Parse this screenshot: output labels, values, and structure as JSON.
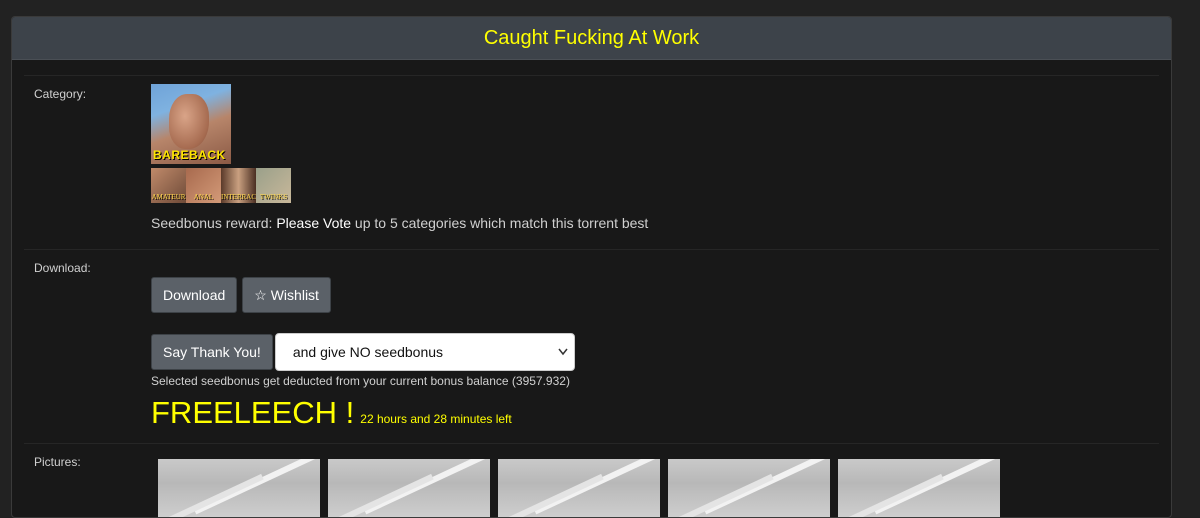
{
  "title": "Caught Fucking At Work",
  "category": {
    "label": "Category:",
    "main_name": "BAREBACK",
    "subcategories": [
      "AMATEUR",
      "ANAL",
      "INTERRACIAL",
      "TWINKS"
    ],
    "seedbonus_prefix": "Seedbonus reward: ",
    "seedbonus_link": "Please Vote",
    "seedbonus_suffix": " up to 5 categories which match this torrent best"
  },
  "download": {
    "label": "Download:",
    "download_button": "Download",
    "wishlist_button": "Wishlist",
    "thank_button": "Say Thank You!",
    "select_value": "and give NO seedbonus",
    "note": "Selected seedbonus get deducted from your current bonus balance (3957.932)",
    "freeleech": "FREELEECH !",
    "time_left": "22 hours and 28 minutes left"
  },
  "pictures": {
    "label": "Pictures:",
    "count": 5
  },
  "colors": {
    "accent_yellow": "#ffff00",
    "header_bg": "#3d434a",
    "button_bg": "#5b6168"
  }
}
